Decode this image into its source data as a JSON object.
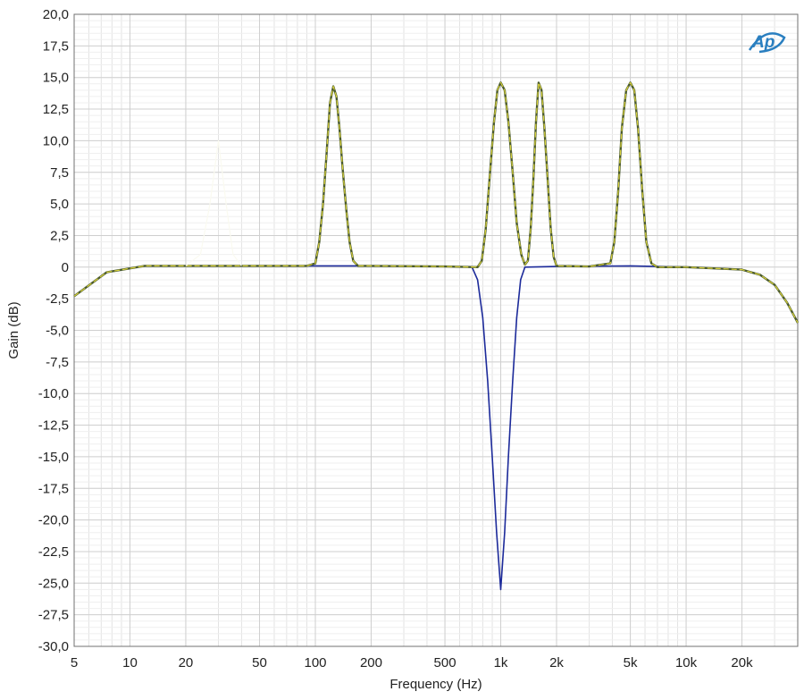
{
  "chart_data": {
    "type": "line",
    "xlabel": "Frequency (Hz)",
    "ylabel": "Gain (dB)",
    "x_scale": "log",
    "xlim": [
      5,
      40000
    ],
    "ylim": [
      -30,
      20
    ],
    "grid": true,
    "x_ticks": [
      {
        "value": 5,
        "label": "5"
      },
      {
        "value": 10,
        "label": "10"
      },
      {
        "value": 20,
        "label": "20"
      },
      {
        "value": 50,
        "label": "50"
      },
      {
        "value": 100,
        "label": "100"
      },
      {
        "value": 200,
        "label": "200"
      },
      {
        "value": 500,
        "label": "500"
      },
      {
        "value": 1000,
        "label": "1k"
      },
      {
        "value": 2000,
        "label": "2k"
      },
      {
        "value": 5000,
        "label": "5k"
      },
      {
        "value": 10000,
        "label": "10k"
      },
      {
        "value": 20000,
        "label": "20k"
      }
    ],
    "y_ticks": [
      {
        "value": 20,
        "label": "20,0"
      },
      {
        "value": 17.5,
        "label": "17,5"
      },
      {
        "value": 15,
        "label": "15,0"
      },
      {
        "value": 12.5,
        "label": "12,5"
      },
      {
        "value": 10,
        "label": "10,0"
      },
      {
        "value": 7.5,
        "label": "7,5"
      },
      {
        "value": 5,
        "label": "5,0"
      },
      {
        "value": 2.5,
        "label": "2,5"
      },
      {
        "value": 0,
        "label": "0"
      },
      {
        "value": -2.5,
        "label": "-2,5"
      },
      {
        "value": -5,
        "label": "-5,0"
      },
      {
        "value": -7.5,
        "label": "-7,5"
      },
      {
        "value": -10,
        "label": "-10,0"
      },
      {
        "value": -12.5,
        "label": "-12,5"
      },
      {
        "value": -15,
        "label": "-15,0"
      },
      {
        "value": -17.5,
        "label": "-17,5"
      },
      {
        "value": -20,
        "label": "-20,0"
      },
      {
        "value": -22.5,
        "label": "-22,5"
      },
      {
        "value": -25,
        "label": "-25,0"
      },
      {
        "value": -27.5,
        "label": "-27,5"
      },
      {
        "value": -30,
        "label": "-30,0"
      }
    ],
    "series": [
      {
        "color": "#1c2a9a",
        "points": [
          [
            5,
            -2.3
          ],
          [
            7.5,
            -0.4
          ],
          [
            10,
            -0.1
          ],
          [
            12,
            0.1
          ],
          [
            20,
            0.1
          ],
          [
            100,
            0.1
          ],
          [
            200,
            0.1
          ],
          [
            500,
            0.05
          ],
          [
            700,
            0
          ],
          [
            750,
            -1
          ],
          [
            800,
            -4
          ],
          [
            850,
            -9
          ],
          [
            900,
            -15
          ],
          [
            950,
            -21
          ],
          [
            1000,
            -25.5
          ],
          [
            1050,
            -21
          ],
          [
            1100,
            -15
          ],
          [
            1160,
            -9
          ],
          [
            1220,
            -4
          ],
          [
            1280,
            -1
          ],
          [
            1350,
            0
          ],
          [
            2000,
            0.05
          ],
          [
            5000,
            0.1
          ],
          [
            10000,
            0
          ],
          [
            20000,
            -0.2
          ],
          [
            25000,
            -0.6
          ],
          [
            30000,
            -1.4
          ],
          [
            35000,
            -2.8
          ],
          [
            40000,
            -4.4
          ]
        ]
      },
      {
        "color": "#4a5a2e",
        "points": [
          [
            5,
            -2.3
          ],
          [
            7.5,
            -0.4
          ],
          [
            10,
            -0.1
          ],
          [
            12,
            0.1
          ],
          [
            20,
            0.1
          ],
          [
            90,
            0.1
          ],
          [
            100,
            0.3
          ],
          [
            105,
            2
          ],
          [
            110,
            5
          ],
          [
            115,
            9
          ],
          [
            120,
            13
          ],
          [
            125,
            14.3
          ],
          [
            130,
            13.5
          ],
          [
            135,
            11
          ],
          [
            140,
            8
          ],
          [
            147,
            4.5
          ],
          [
            153,
            2
          ],
          [
            160,
            0.5
          ],
          [
            170,
            0.1
          ],
          [
            200,
            0.1
          ],
          [
            500,
            0.05
          ],
          [
            750,
            0
          ],
          [
            790,
            0.5
          ],
          [
            830,
            3
          ],
          [
            870,
            7
          ],
          [
            920,
            11.5
          ],
          [
            960,
            14
          ],
          [
            1000,
            14.6
          ],
          [
            1050,
            14
          ],
          [
            1100,
            11.5
          ],
          [
            1160,
            7.5
          ],
          [
            1220,
            3.5
          ],
          [
            1290,
            1
          ],
          [
            1350,
            0.2
          ],
          [
            1400,
            0.5
          ],
          [
            1450,
            3
          ],
          [
            1500,
            7
          ],
          [
            1550,
            11.5
          ],
          [
            1600,
            14.6
          ],
          [
            1660,
            14
          ],
          [
            1720,
            11
          ],
          [
            1790,
            7
          ],
          [
            1860,
            3
          ],
          [
            1930,
            0.8
          ],
          [
            2000,
            0.1
          ],
          [
            3000,
            0.05
          ],
          [
            3900,
            0.3
          ],
          [
            4100,
            2
          ],
          [
            4300,
            6
          ],
          [
            4500,
            11
          ],
          [
            4750,
            14
          ],
          [
            5000,
            14.6
          ],
          [
            5250,
            14
          ],
          [
            5500,
            11
          ],
          [
            5800,
            6
          ],
          [
            6100,
            2
          ],
          [
            6500,
            0.3
          ],
          [
            7000,
            0
          ],
          [
            10000,
            0
          ],
          [
            20000,
            -0.2
          ],
          [
            25000,
            -0.6
          ],
          [
            30000,
            -1.4
          ],
          [
            35000,
            -2.8
          ],
          [
            40000,
            -4.4
          ]
        ]
      },
      {
        "color": "#d9d23a",
        "points": [
          [
            5,
            -2.3
          ],
          [
            7.5,
            -0.4
          ],
          [
            10,
            -0.1
          ],
          [
            12,
            0.1
          ],
          [
            20,
            0.1
          ],
          [
            90,
            0.1
          ],
          [
            100,
            0.3
          ],
          [
            105,
            2
          ],
          [
            110,
            5
          ],
          [
            115,
            9
          ],
          [
            120,
            13
          ],
          [
            125,
            14.3
          ],
          [
            130,
            13.5
          ],
          [
            135,
            11
          ],
          [
            140,
            8
          ],
          [
            147,
            4.5
          ],
          [
            153,
            2
          ],
          [
            160,
            0.5
          ],
          [
            170,
            0.1
          ],
          [
            200,
            0.1
          ],
          [
            500,
            0.05
          ],
          [
            750,
            0
          ],
          [
            790,
            0.5
          ],
          [
            830,
            3
          ],
          [
            870,
            7
          ],
          [
            920,
            11.5
          ],
          [
            960,
            14
          ],
          [
            1000,
            14.6
          ],
          [
            1050,
            14
          ],
          [
            1100,
            11.5
          ],
          [
            1160,
            7.5
          ],
          [
            1220,
            3.5
          ],
          [
            1290,
            1
          ],
          [
            1350,
            0.2
          ],
          [
            1400,
            0.5
          ],
          [
            1450,
            3
          ],
          [
            1500,
            7
          ],
          [
            1550,
            11.5
          ],
          [
            1600,
            14.6
          ],
          [
            1660,
            14
          ],
          [
            1720,
            11
          ],
          [
            1790,
            7
          ],
          [
            1860,
            3
          ],
          [
            1930,
            0.8
          ],
          [
            2000,
            0.1
          ],
          [
            3000,
            0.05
          ],
          [
            3900,
            0.3
          ],
          [
            4100,
            2
          ],
          [
            4300,
            6
          ],
          [
            4500,
            11
          ],
          [
            4750,
            14
          ],
          [
            5000,
            14.6
          ],
          [
            5250,
            14
          ],
          [
            5500,
            11
          ],
          [
            5800,
            6
          ],
          [
            6100,
            2
          ],
          [
            6500,
            0.3
          ],
          [
            7000,
            0
          ],
          [
            10000,
            0
          ],
          [
            20000,
            -0.2
          ],
          [
            25000,
            -0.6
          ],
          [
            30000,
            -1.4
          ],
          [
            35000,
            -2.8
          ],
          [
            40000,
            -4.4
          ]
        ]
      },
      {
        "color": "#fafaf0",
        "points": [
          [
            20,
            0.1
          ],
          [
            24,
            1
          ],
          [
            27,
            5
          ],
          [
            30,
            10
          ],
          [
            33,
            5
          ],
          [
            36,
            1
          ],
          [
            40,
            0.1
          ]
        ]
      }
    ]
  },
  "logo": {
    "text": "Ap",
    "color": "#2a7fc0"
  }
}
